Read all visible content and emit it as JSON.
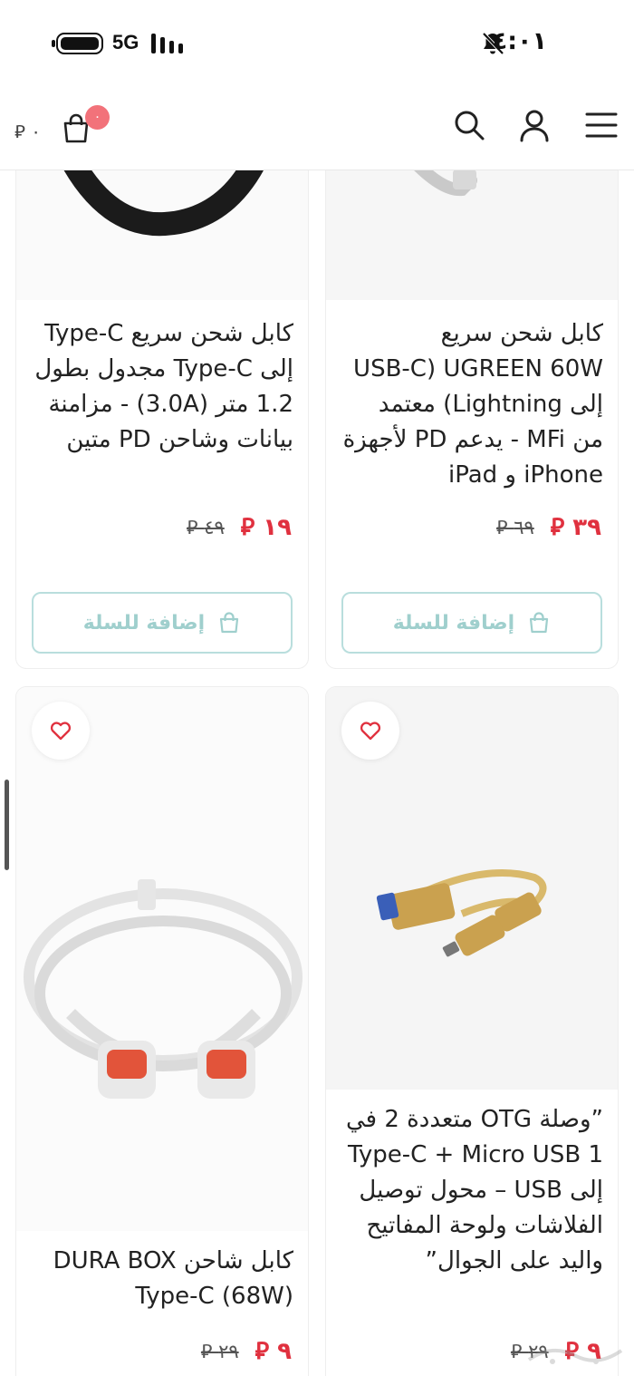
{
  "status_bar": {
    "network": "5G",
    "time": "٤:٠١",
    "battery_level": 1.0,
    "icons": [
      "battery-icon",
      "signal-icon",
      "bell-muted-icon"
    ]
  },
  "header": {
    "cart_total": "٠ ⃁",
    "cart_count": "٠",
    "icons": [
      "menu-icon",
      "user-icon",
      "search-icon",
      "cart-icon"
    ],
    "badge_color": "#f2727a"
  },
  "products": [
    {
      "title": "كابل شحن سريع UGREEN 60W (USB-C إلى Lightning) معتمد من MFi - يدعم PD لأجهزة iPhone و iPad",
      "price_new": "٣٩ ⃁",
      "price_old": "٦٩ ⃁",
      "add_to_cart": "إضافة للسلة"
    },
    {
      "title": "كابل شحن سريع Type-C إلى Type-C مجدول بطول 1.2 متر (3.0A) - مزامنة بيانات وشاحن PD متين",
      "price_new": "١٩ ⃁",
      "price_old": "٤٩ ⃁",
      "add_to_cart": "إضافة للسلة"
    },
    {
      "title": "”وصلة OTG متعددة 2 في 1 Type-C + Micro USB إلى USB – محول توصيل الفلاشات ولوحة المفاتيح واليد على الجوال”",
      "price_new": "٩ ⃁",
      "price_old": "٢٩ ⃁"
    },
    {
      "title": "كابل شاحن DURA BOX Type-C (68W)",
      "price_new": "٩ ⃁",
      "price_old": "٢٩ ⃁"
    }
  ],
  "colors": {
    "price_new": "#e0313f",
    "add_button_border": "#b9dedd",
    "add_button_text": "#9fcfcd",
    "favorite": "#e0313f"
  }
}
